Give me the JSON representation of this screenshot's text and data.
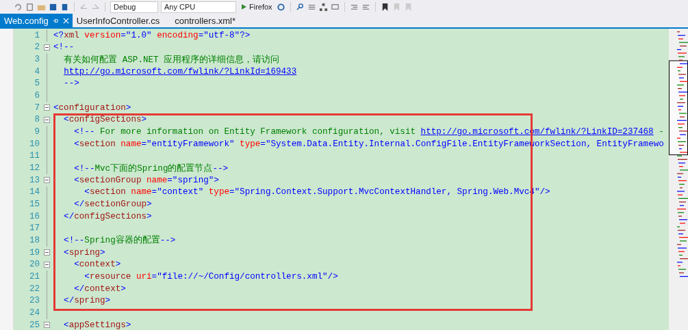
{
  "toolbar": {
    "configuration": "Debug",
    "platform": "Any CPU",
    "run_target": "Firefox"
  },
  "tabs": [
    {
      "label": "Web.config",
      "selected": true
    },
    {
      "label": "UserInfoController.cs",
      "selected": false
    },
    {
      "label": "controllers.xml*",
      "selected": false
    }
  ],
  "editor": {
    "lines": [
      {
        "number": "1",
        "fold": false,
        "tokens": [
          {
            "kind": "delim",
            "text": "<?"
          },
          {
            "kind": "tag",
            "text": "xml"
          },
          {
            "kind": "attr",
            "text": " version"
          },
          {
            "kind": "delim",
            "text": "="
          },
          {
            "kind": "value",
            "text": "\"1.0\""
          },
          {
            "kind": "attr",
            "text": " encoding"
          },
          {
            "kind": "delim",
            "text": "="
          },
          {
            "kind": "value",
            "text": "\"utf-8\""
          },
          {
            "kind": "delim",
            "text": "?>"
          }
        ]
      },
      {
        "number": "2",
        "fold": true,
        "tokens": [
          {
            "kind": "delim",
            "text": "<!--"
          }
        ]
      },
      {
        "number": "3",
        "fold": false,
        "tokens": [
          {
            "kind": "comment",
            "text": "  有关如何配置 ASP.NET 应用程序的详细信息，请访问"
          }
        ]
      },
      {
        "number": "4",
        "fold": false,
        "tokens": [
          {
            "kind": "link",
            "text": "  http://go.microsoft.com/fwlink/?LinkId=169433"
          }
        ]
      },
      {
        "number": "5",
        "fold": false,
        "tokens": [
          {
            "kind": "delim",
            "text": "  -->"
          }
        ]
      },
      {
        "number": "6",
        "fold": false
      },
      {
        "number": "7",
        "fold": true,
        "tokens": [
          {
            "kind": "delim",
            "text": "<"
          },
          {
            "kind": "tag",
            "text": "configuration"
          },
          {
            "kind": "delim",
            "text": ">"
          }
        ]
      },
      {
        "number": "8",
        "fold": true,
        "tokens": [
          {
            "kind": "delim",
            "text": "  <"
          },
          {
            "kind": "tag",
            "text": "configSections"
          },
          {
            "kind": "delim",
            "text": ">"
          }
        ]
      },
      {
        "number": "9",
        "fold": false,
        "tokens": [
          {
            "kind": "delim",
            "text": "    <!--"
          },
          {
            "kind": "comment",
            "text": " For more information on Entity Framework configuration, visit "
          },
          {
            "kind": "link",
            "text": "http://go.microsoft.com/fwlink/?LinkID=237468"
          },
          {
            "kind": "comment",
            "text": " -"
          }
        ]
      },
      {
        "number": "10",
        "fold": false,
        "tokens": [
          {
            "kind": "delim",
            "text": "    <"
          },
          {
            "kind": "tag",
            "text": "section"
          },
          {
            "kind": "attr",
            "text": " name"
          },
          {
            "kind": "delim",
            "text": "="
          },
          {
            "kind": "value",
            "text": "\"entityFramework\""
          },
          {
            "kind": "attr",
            "text": " type"
          },
          {
            "kind": "delim",
            "text": "="
          },
          {
            "kind": "value",
            "text": "\"System.Data.Entity.Internal.ConfigFile.EntityFrameworkSection, EntityFramewo"
          }
        ]
      },
      {
        "number": "11",
        "fold": false
      },
      {
        "number": "12",
        "fold": false,
        "tokens": [
          {
            "kind": "delim",
            "text": "    <!--"
          },
          {
            "kind": "comment",
            "text": "Mvc下面的Spring的配置节点"
          },
          {
            "kind": "delim",
            "text": "-->"
          }
        ]
      },
      {
        "number": "13",
        "fold": true,
        "tokens": [
          {
            "kind": "delim",
            "text": "    <"
          },
          {
            "kind": "tag",
            "text": "sectionGroup"
          },
          {
            "kind": "attr",
            "text": " name"
          },
          {
            "kind": "delim",
            "text": "="
          },
          {
            "kind": "value",
            "text": "\"spring\""
          },
          {
            "kind": "delim",
            "text": ">"
          }
        ]
      },
      {
        "number": "14",
        "fold": false,
        "tokens": [
          {
            "kind": "delim",
            "text": "      <"
          },
          {
            "kind": "tag",
            "text": "section"
          },
          {
            "kind": "attr",
            "text": " name"
          },
          {
            "kind": "delim",
            "text": "="
          },
          {
            "kind": "value",
            "text": "\"context\""
          },
          {
            "kind": "attr",
            "text": " type"
          },
          {
            "kind": "delim",
            "text": "="
          },
          {
            "kind": "value",
            "text": "\"Spring.Context.Support.MvcContextHandler, Spring.Web.Mvc4\""
          },
          {
            "kind": "delim",
            "text": "/>"
          }
        ]
      },
      {
        "number": "15",
        "fold": false,
        "tokens": [
          {
            "kind": "delim",
            "text": "    </"
          },
          {
            "kind": "tag",
            "text": "sectionGroup"
          },
          {
            "kind": "delim",
            "text": ">"
          }
        ]
      },
      {
        "number": "16",
        "fold": false,
        "tokens": [
          {
            "kind": "delim",
            "text": "  </"
          },
          {
            "kind": "tag",
            "text": "configSections"
          },
          {
            "kind": "delim",
            "text": ">"
          }
        ]
      },
      {
        "number": "17",
        "fold": false
      },
      {
        "number": "18",
        "fold": false,
        "tokens": [
          {
            "kind": "delim",
            "text": "  <!--"
          },
          {
            "kind": "comment",
            "text": "Spring容器的配置"
          },
          {
            "kind": "delim",
            "text": "-->"
          }
        ]
      },
      {
        "number": "19",
        "fold": true,
        "tokens": [
          {
            "kind": "delim",
            "text": "  <"
          },
          {
            "kind": "tag",
            "text": "spring"
          },
          {
            "kind": "delim",
            "text": ">"
          }
        ]
      },
      {
        "number": "20",
        "fold": true,
        "tokens": [
          {
            "kind": "delim",
            "text": "    <"
          },
          {
            "kind": "tag",
            "text": "context"
          },
          {
            "kind": "delim",
            "text": ">"
          }
        ]
      },
      {
        "number": "21",
        "fold": false,
        "tokens": [
          {
            "kind": "delim",
            "text": "      <"
          },
          {
            "kind": "tag",
            "text": "resource"
          },
          {
            "kind": "attr",
            "text": " uri"
          },
          {
            "kind": "delim",
            "text": "="
          },
          {
            "kind": "value",
            "text": "\"file://~/Config/controllers.xml\""
          },
          {
            "kind": "delim",
            "text": "/>"
          }
        ]
      },
      {
        "number": "22",
        "fold": false,
        "tokens": [
          {
            "kind": "delim",
            "text": "    </"
          },
          {
            "kind": "tag",
            "text": "context"
          },
          {
            "kind": "delim",
            "text": ">"
          }
        ]
      },
      {
        "number": "23",
        "fold": false,
        "tokens": [
          {
            "kind": "delim",
            "text": "  </"
          },
          {
            "kind": "tag",
            "text": "spring"
          },
          {
            "kind": "delim",
            "text": ">"
          }
        ]
      },
      {
        "number": "24",
        "fold": false
      },
      {
        "number": "25",
        "fold": true,
        "tokens": [
          {
            "kind": "delim",
            "text": "  <"
          },
          {
            "kind": "tag",
            "text": "appSettings"
          },
          {
            "kind": "delim",
            "text": ">"
          }
        ]
      }
    ]
  }
}
